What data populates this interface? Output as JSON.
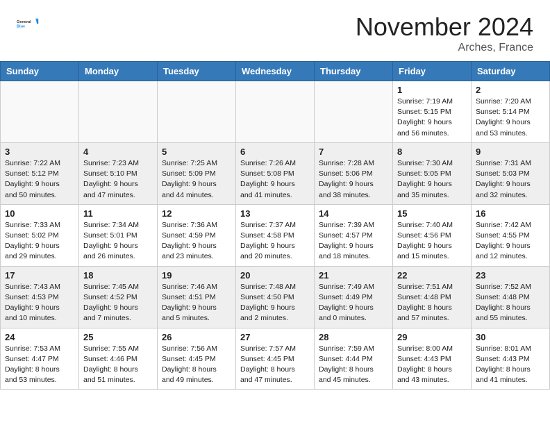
{
  "header": {
    "logo_general": "General",
    "logo_blue": "Blue",
    "month": "November 2024",
    "location": "Arches, France"
  },
  "days_of_week": [
    "Sunday",
    "Monday",
    "Tuesday",
    "Wednesday",
    "Thursday",
    "Friday",
    "Saturday"
  ],
  "weeks": [
    [
      {
        "day": "",
        "info": ""
      },
      {
        "day": "",
        "info": ""
      },
      {
        "day": "",
        "info": ""
      },
      {
        "day": "",
        "info": ""
      },
      {
        "day": "",
        "info": ""
      },
      {
        "day": "1",
        "info": "Sunrise: 7:19 AM\nSunset: 5:15 PM\nDaylight: 9 hours\nand 56 minutes."
      },
      {
        "day": "2",
        "info": "Sunrise: 7:20 AM\nSunset: 5:14 PM\nDaylight: 9 hours\nand 53 minutes."
      }
    ],
    [
      {
        "day": "3",
        "info": "Sunrise: 7:22 AM\nSunset: 5:12 PM\nDaylight: 9 hours\nand 50 minutes."
      },
      {
        "day": "4",
        "info": "Sunrise: 7:23 AM\nSunset: 5:10 PM\nDaylight: 9 hours\nand 47 minutes."
      },
      {
        "day": "5",
        "info": "Sunrise: 7:25 AM\nSunset: 5:09 PM\nDaylight: 9 hours\nand 44 minutes."
      },
      {
        "day": "6",
        "info": "Sunrise: 7:26 AM\nSunset: 5:08 PM\nDaylight: 9 hours\nand 41 minutes."
      },
      {
        "day": "7",
        "info": "Sunrise: 7:28 AM\nSunset: 5:06 PM\nDaylight: 9 hours\nand 38 minutes."
      },
      {
        "day": "8",
        "info": "Sunrise: 7:30 AM\nSunset: 5:05 PM\nDaylight: 9 hours\nand 35 minutes."
      },
      {
        "day": "9",
        "info": "Sunrise: 7:31 AM\nSunset: 5:03 PM\nDaylight: 9 hours\nand 32 minutes."
      }
    ],
    [
      {
        "day": "10",
        "info": "Sunrise: 7:33 AM\nSunset: 5:02 PM\nDaylight: 9 hours\nand 29 minutes."
      },
      {
        "day": "11",
        "info": "Sunrise: 7:34 AM\nSunset: 5:01 PM\nDaylight: 9 hours\nand 26 minutes."
      },
      {
        "day": "12",
        "info": "Sunrise: 7:36 AM\nSunset: 4:59 PM\nDaylight: 9 hours\nand 23 minutes."
      },
      {
        "day": "13",
        "info": "Sunrise: 7:37 AM\nSunset: 4:58 PM\nDaylight: 9 hours\nand 20 minutes."
      },
      {
        "day": "14",
        "info": "Sunrise: 7:39 AM\nSunset: 4:57 PM\nDaylight: 9 hours\nand 18 minutes."
      },
      {
        "day": "15",
        "info": "Sunrise: 7:40 AM\nSunset: 4:56 PM\nDaylight: 9 hours\nand 15 minutes."
      },
      {
        "day": "16",
        "info": "Sunrise: 7:42 AM\nSunset: 4:55 PM\nDaylight: 9 hours\nand 12 minutes."
      }
    ],
    [
      {
        "day": "17",
        "info": "Sunrise: 7:43 AM\nSunset: 4:53 PM\nDaylight: 9 hours\nand 10 minutes."
      },
      {
        "day": "18",
        "info": "Sunrise: 7:45 AM\nSunset: 4:52 PM\nDaylight: 9 hours\nand 7 minutes."
      },
      {
        "day": "19",
        "info": "Sunrise: 7:46 AM\nSunset: 4:51 PM\nDaylight: 9 hours\nand 5 minutes."
      },
      {
        "day": "20",
        "info": "Sunrise: 7:48 AM\nSunset: 4:50 PM\nDaylight: 9 hours\nand 2 minutes."
      },
      {
        "day": "21",
        "info": "Sunrise: 7:49 AM\nSunset: 4:49 PM\nDaylight: 9 hours\nand 0 minutes."
      },
      {
        "day": "22",
        "info": "Sunrise: 7:51 AM\nSunset: 4:48 PM\nDaylight: 8 hours\nand 57 minutes."
      },
      {
        "day": "23",
        "info": "Sunrise: 7:52 AM\nSunset: 4:48 PM\nDaylight: 8 hours\nand 55 minutes."
      }
    ],
    [
      {
        "day": "24",
        "info": "Sunrise: 7:53 AM\nSunset: 4:47 PM\nDaylight: 8 hours\nand 53 minutes."
      },
      {
        "day": "25",
        "info": "Sunrise: 7:55 AM\nSunset: 4:46 PM\nDaylight: 8 hours\nand 51 minutes."
      },
      {
        "day": "26",
        "info": "Sunrise: 7:56 AM\nSunset: 4:45 PM\nDaylight: 8 hours\nand 49 minutes."
      },
      {
        "day": "27",
        "info": "Sunrise: 7:57 AM\nSunset: 4:45 PM\nDaylight: 8 hours\nand 47 minutes."
      },
      {
        "day": "28",
        "info": "Sunrise: 7:59 AM\nSunset: 4:44 PM\nDaylight: 8 hours\nand 45 minutes."
      },
      {
        "day": "29",
        "info": "Sunrise: 8:00 AM\nSunset: 4:43 PM\nDaylight: 8 hours\nand 43 minutes."
      },
      {
        "day": "30",
        "info": "Sunrise: 8:01 AM\nSunset: 4:43 PM\nDaylight: 8 hours\nand 41 minutes."
      }
    ]
  ]
}
